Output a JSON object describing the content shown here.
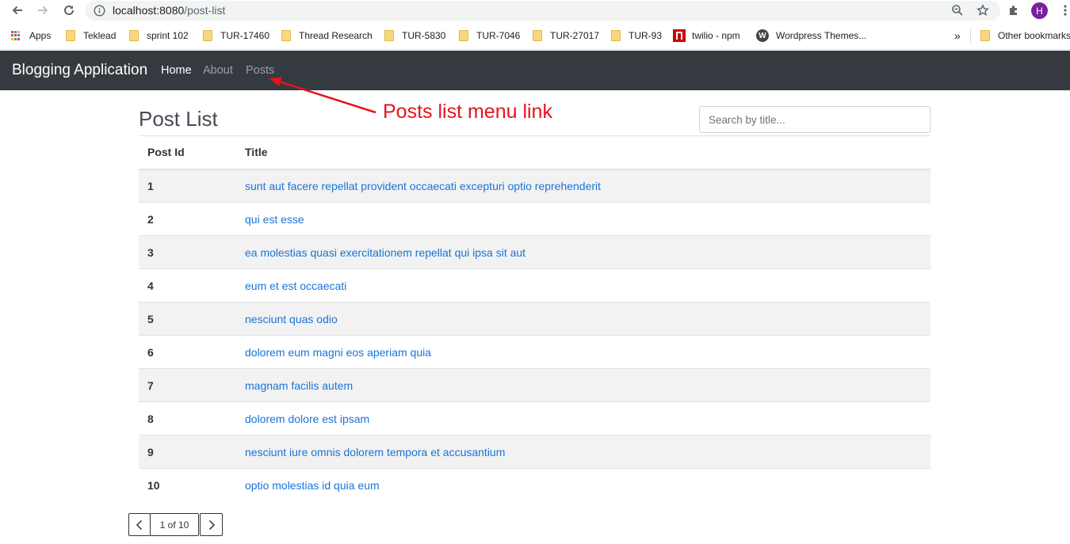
{
  "browser": {
    "url_host": "localhost:8080",
    "url_path": "/post-list",
    "profile_initial": "H"
  },
  "bookmarks": {
    "items": [
      "Apps",
      "Teklead",
      "sprint 102",
      "TUR-17460",
      "Thread Research",
      "TUR-5830",
      "TUR-7046",
      "TUR-27017",
      "TUR-93",
      "twilio - npm",
      "Wordpress Themes..."
    ],
    "more": "»",
    "other": "Other bookmarks"
  },
  "navbar": {
    "brand": "Blogging Application",
    "links": [
      "Home",
      "About",
      "Posts"
    ]
  },
  "annotation": {
    "text": "Posts list menu link",
    "color": "#e8121c"
  },
  "page": {
    "title": "Post List",
    "search_placeholder": "Search by title..."
  },
  "table": {
    "headers": [
      "Post Id",
      "Title"
    ],
    "rows": [
      {
        "id": "1",
        "title": "sunt aut facere repellat provident occaecati excepturi optio reprehenderit"
      },
      {
        "id": "2",
        "title": "qui est esse"
      },
      {
        "id": "3",
        "title": "ea molestias quasi exercitationem repellat qui ipsa sit aut"
      },
      {
        "id": "4",
        "title": "eum et est occaecati"
      },
      {
        "id": "5",
        "title": "nesciunt quas odio"
      },
      {
        "id": "6",
        "title": "dolorem eum magni eos aperiam quia"
      },
      {
        "id": "7",
        "title": "magnam facilis autem"
      },
      {
        "id": "8",
        "title": "dolorem dolore est ipsam"
      },
      {
        "id": "9",
        "title": "nesciunt iure omnis dolorem tempora et accusantium"
      },
      {
        "id": "10",
        "title": "optio molestias id quia eum"
      }
    ]
  },
  "pagination": {
    "label": "1 of 10"
  },
  "colors": {
    "navbar_bg": "#343a40",
    "link": "#1a73d9",
    "stripe": "#f2f2f2"
  }
}
